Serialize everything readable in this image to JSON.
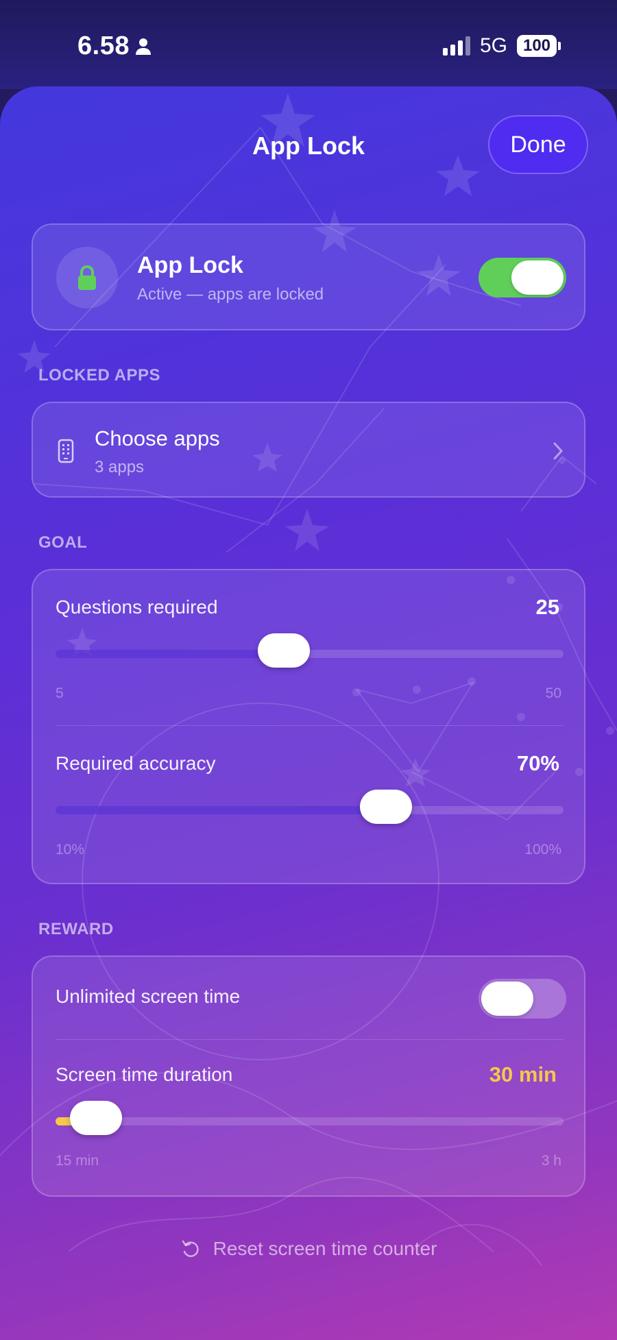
{
  "status": {
    "time": "6.58",
    "network": "5G",
    "battery": "100"
  },
  "header": {
    "title": "App Lock",
    "done_label": "Done"
  },
  "app_lock": {
    "title": "App Lock",
    "subtitle": "Active — apps are locked",
    "enabled": true,
    "icon": "lock-icon",
    "toggle_color": "#5fcf5a"
  },
  "locked_apps": {
    "section_label": "LOCKED APPS",
    "title": "Choose apps",
    "subtitle": "3 apps",
    "icon": "phone-icon"
  },
  "goal": {
    "section_label": "GOAL",
    "questions": {
      "label": "Questions required",
      "value": "25",
      "min": "5",
      "max": "50",
      "level": 0.45
    },
    "accuracy": {
      "label": "Required accuracy",
      "value": "70%",
      "min": "10%",
      "max": "100%",
      "level": 0.65
    }
  },
  "reward": {
    "section_label": "REWARD",
    "unlimited": {
      "label": "Unlimited screen time",
      "enabled": false
    },
    "duration": {
      "label": "Screen time duration",
      "value": "30 min",
      "min": "15 min",
      "max": "3 h",
      "level": 0.08,
      "accent": "#f5c84a"
    }
  },
  "reset_label": "Reset screen time counter"
}
